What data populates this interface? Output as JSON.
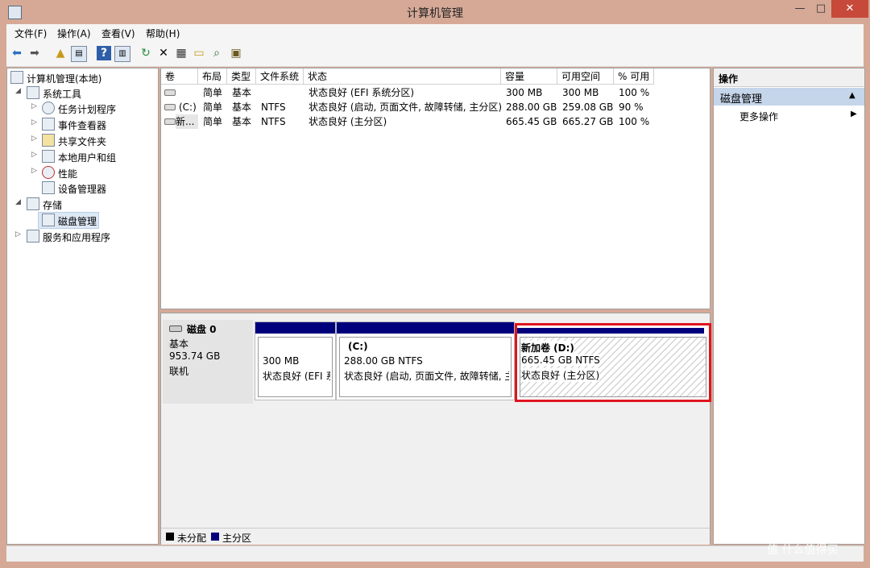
{
  "window": {
    "title": "计算机管理",
    "minimize": "—",
    "maximize": "□",
    "close": "✕"
  },
  "menu": [
    "文件(F)",
    "操作(A)",
    "查看(V)",
    "帮助(H)"
  ],
  "tree": {
    "root": "计算机管理(本地)",
    "system_tools": "系统工具",
    "task_scheduler": "任务计划程序",
    "event_viewer": "事件查看器",
    "shared_folders": "共享文件夹",
    "local_users": "本地用户和组",
    "performance": "性能",
    "device_manager": "设备管理器",
    "storage": "存储",
    "disk_management": "磁盘管理",
    "services_apps": "服务和应用程序"
  },
  "columns": [
    "卷",
    "布局",
    "类型",
    "文件系统",
    "状态",
    "容量",
    "可用空间",
    "% 可用"
  ],
  "volumes": [
    {
      "vol": "",
      "layout": "简单",
      "type": "基本",
      "fs": "",
      "status": "状态良好 (EFI 系统分区)",
      "capacity": "300 MB",
      "free": "300 MB",
      "pct": "100 %"
    },
    {
      "vol": "(C:)",
      "layout": "简单",
      "type": "基本",
      "fs": "NTFS",
      "status": "状态良好 (启动, 页面文件, 故障转储, 主分区)",
      "capacity": "288.00 GB",
      "free": "259.08 GB",
      "pct": "90 %"
    },
    {
      "vol": "新...",
      "layout": "简单",
      "type": "基本",
      "fs": "NTFS",
      "status": "状态良好 (主分区)",
      "capacity": "665.45 GB",
      "free": "665.27 GB",
      "pct": "100 %"
    }
  ],
  "disk": {
    "name": "磁盘 0",
    "type": "基本",
    "size": "953.74 GB",
    "state": "联机"
  },
  "partitions": [
    {
      "title": "",
      "size": "300 MB",
      "status": "状态良好 (EFI 系"
    },
    {
      "title": "(C:)",
      "size": "288.00 GB NTFS",
      "status": "状态良好 (启动, 页面文件, 故障转储, 主"
    },
    {
      "title": "新加卷  (D:)",
      "size": "665.45 GB NTFS",
      "status": "状态良好 (主分区)"
    }
  ],
  "legend": {
    "unallocated": "未分配",
    "primary": "主分区"
  },
  "actions": {
    "header": "操作",
    "section": "磁盘管理",
    "more": "更多操作"
  },
  "watermark": "值 什么值得买",
  "colors": {
    "titlebar": "#d6a997",
    "primary_partition": "#00007c",
    "highlight": "#e0141e",
    "close": "#c7493a"
  }
}
